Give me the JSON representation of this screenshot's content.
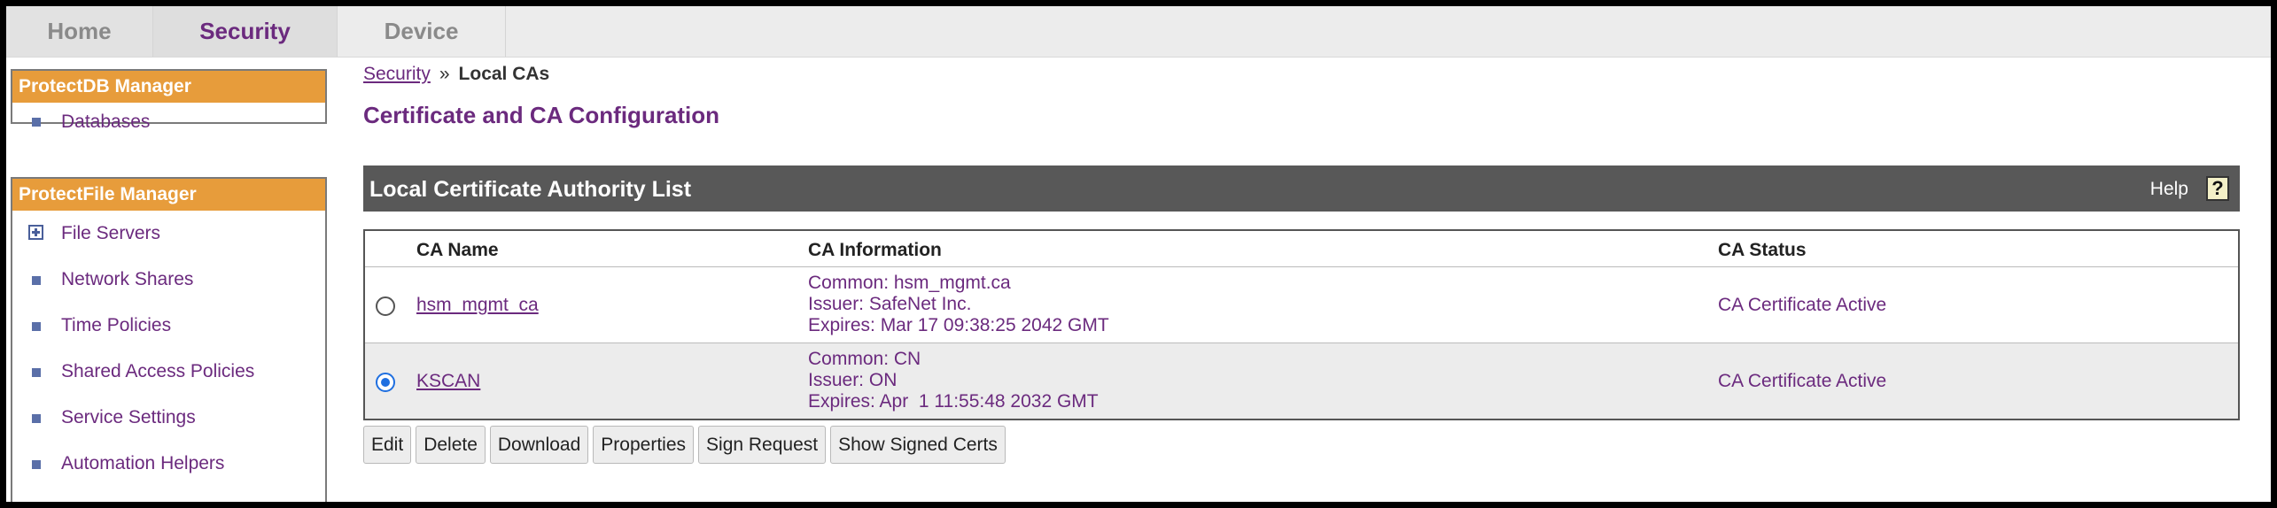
{
  "tabs": [
    {
      "label": "Home"
    },
    {
      "label": "Security"
    },
    {
      "label": "Device"
    }
  ],
  "sidebar": {
    "protectdb": {
      "title": "ProtectDB Manager",
      "items": [
        {
          "label": "Databases"
        }
      ]
    },
    "protectfile": {
      "title": "ProtectFile Manager",
      "items": [
        {
          "label": "File Servers",
          "icon": "plus-box-icon"
        },
        {
          "label": "Network Shares"
        },
        {
          "label": "Time Policies"
        },
        {
          "label": "Shared Access Policies"
        },
        {
          "label": "Service Settings"
        },
        {
          "label": "Automation Helpers"
        }
      ]
    }
  },
  "breadcrumb": {
    "link": "Security",
    "separator": "»",
    "current": "Local CAs"
  },
  "page_title": "Certificate and CA Configuration",
  "list": {
    "title": "Local Certificate Authority List",
    "help_label": "Help",
    "help_icon": "?",
    "columns": [
      "CA Name",
      "CA Information",
      "CA Status"
    ],
    "rows": [
      {
        "selected": false,
        "name": "hsm_mgmt_ca",
        "info": [
          "Common: hsm_mgmt.ca",
          "Issuer: SafeNet Inc.",
          "Expires: Mar 17 09:38:25 2042 GMT"
        ],
        "status": "CA Certificate Active"
      },
      {
        "selected": true,
        "name": "KSCAN",
        "info": [
          "Common: CN",
          "Issuer: ON",
          "Expires: Apr  1 11:55:48 2032 GMT"
        ],
        "status": "CA Certificate Active"
      }
    ]
  },
  "buttons": [
    "Edit",
    "Delete",
    "Download",
    "Properties",
    "Sign Request",
    "Show Signed Certs"
  ],
  "colors": {
    "accent": "#6b2a7e",
    "sidebar_header": "#e79c3b",
    "list_header": "#585858"
  }
}
